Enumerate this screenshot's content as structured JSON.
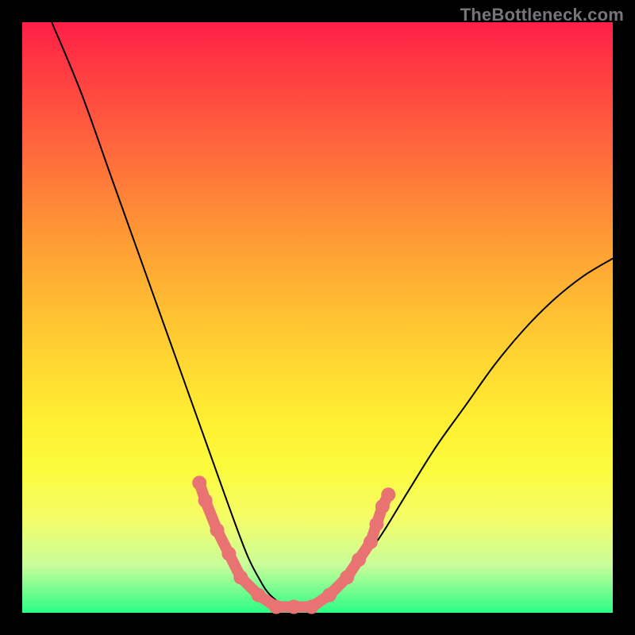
{
  "watermark": "TheBottleneck.com",
  "chart_data": {
    "type": "line",
    "title": "",
    "xlabel": "",
    "ylabel": "",
    "xlim": [
      0,
      100
    ],
    "ylim": [
      0,
      100
    ],
    "grid": false,
    "legend": false,
    "series": [
      {
        "name": "bottleneck-curve",
        "x": [
          5,
          10,
          15,
          20,
          25,
          30,
          35,
          38,
          40,
          42,
          45,
          48,
          50,
          55,
          60,
          65,
          70,
          75,
          80,
          85,
          90,
          95,
          100
        ],
        "y": [
          100,
          88,
          74,
          60,
          46,
          32,
          18,
          10,
          6,
          3,
          1,
          1,
          2,
          6,
          12,
          20,
          28,
          35,
          42,
          48,
          53,
          57,
          60
        ]
      }
    ],
    "markers": {
      "name": "highlight-band",
      "points": [
        {
          "x": 30,
          "y": 22
        },
        {
          "x": 31,
          "y": 19
        },
        {
          "x": 33,
          "y": 14
        },
        {
          "x": 35,
          "y": 10
        },
        {
          "x": 37,
          "y": 6
        },
        {
          "x": 40,
          "y": 3
        },
        {
          "x": 43,
          "y": 1
        },
        {
          "x": 46,
          "y": 1
        },
        {
          "x": 49,
          "y": 1
        },
        {
          "x": 52,
          "y": 3
        },
        {
          "x": 55,
          "y": 6
        },
        {
          "x": 57,
          "y": 9
        },
        {
          "x": 59,
          "y": 12
        },
        {
          "x": 60,
          "y": 15
        },
        {
          "x": 61,
          "y": 18
        },
        {
          "x": 62,
          "y": 20
        }
      ]
    },
    "background_gradient": {
      "top": "#ff1e49",
      "bottom": "#2bfd86"
    }
  }
}
